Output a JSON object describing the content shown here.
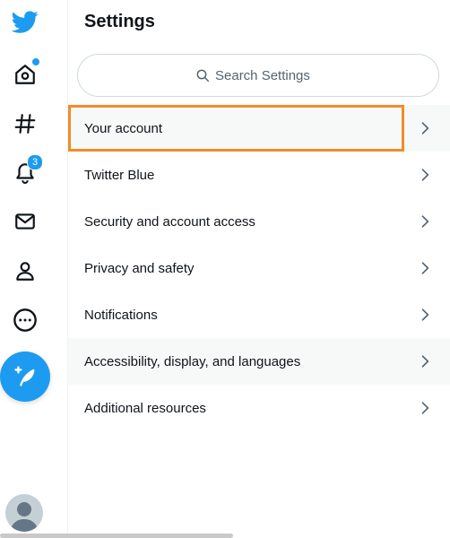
{
  "settings": {
    "title": "Settings",
    "search": {
      "placeholder": "Search Settings",
      "value": ""
    },
    "items": [
      {
        "label": "Your account"
      },
      {
        "label": "Twitter Blue"
      },
      {
        "label": "Security and account access"
      },
      {
        "label": "Privacy and safety"
      },
      {
        "label": "Notifications"
      },
      {
        "label": "Accessibility, display, and languages"
      },
      {
        "label": "Additional resources"
      }
    ]
  },
  "nav": {
    "notifications_badge": "3"
  },
  "colors": {
    "accent": "#1d9bf0",
    "highlight_outline": "#f28c28",
    "text": "#0f1419",
    "muted": "#536471"
  }
}
